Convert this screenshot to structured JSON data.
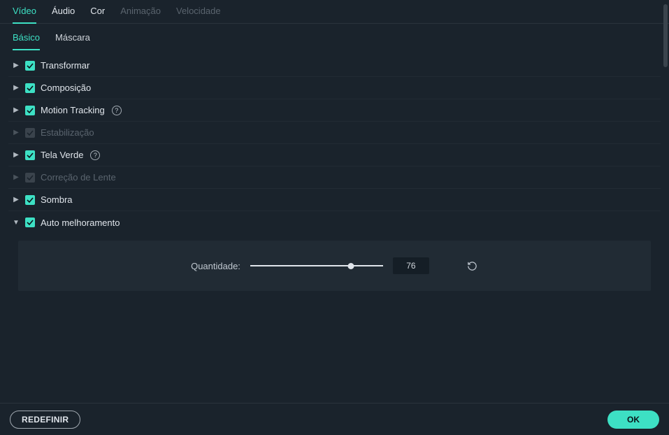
{
  "topTabs": [
    {
      "label": "Vídeo",
      "active": true,
      "disabled": false
    },
    {
      "label": "Áudio",
      "active": false,
      "disabled": false
    },
    {
      "label": "Cor",
      "active": false,
      "disabled": false
    },
    {
      "label": "Animação",
      "active": false,
      "disabled": true
    },
    {
      "label": "Velocidade",
      "active": false,
      "disabled": true
    }
  ],
  "subTabs": [
    {
      "label": "Básico",
      "active": true
    },
    {
      "label": "Máscara",
      "active": false
    }
  ],
  "sections": [
    {
      "label": "Transformar",
      "checked": true,
      "disabled": false,
      "expanded": false,
      "help": false
    },
    {
      "label": "Composição",
      "checked": true,
      "disabled": false,
      "expanded": false,
      "help": false
    },
    {
      "label": "Motion Tracking",
      "checked": true,
      "disabled": false,
      "expanded": false,
      "help": true
    },
    {
      "label": "Estabilização",
      "checked": true,
      "disabled": true,
      "expanded": false,
      "help": false
    },
    {
      "label": "Tela Verde",
      "checked": true,
      "disabled": false,
      "expanded": false,
      "help": true
    },
    {
      "label": "Correção de Lente",
      "checked": true,
      "disabled": true,
      "expanded": false,
      "help": false
    },
    {
      "label": "Sombra",
      "checked": true,
      "disabled": false,
      "expanded": false,
      "help": false
    },
    {
      "label": "Auto melhoramento",
      "checked": true,
      "disabled": false,
      "expanded": true,
      "help": false
    }
  ],
  "autoEnhance": {
    "paramLabel": "Quantidade:",
    "value": "76"
  },
  "footer": {
    "reset": "REDEFINIR",
    "ok": "OK"
  }
}
